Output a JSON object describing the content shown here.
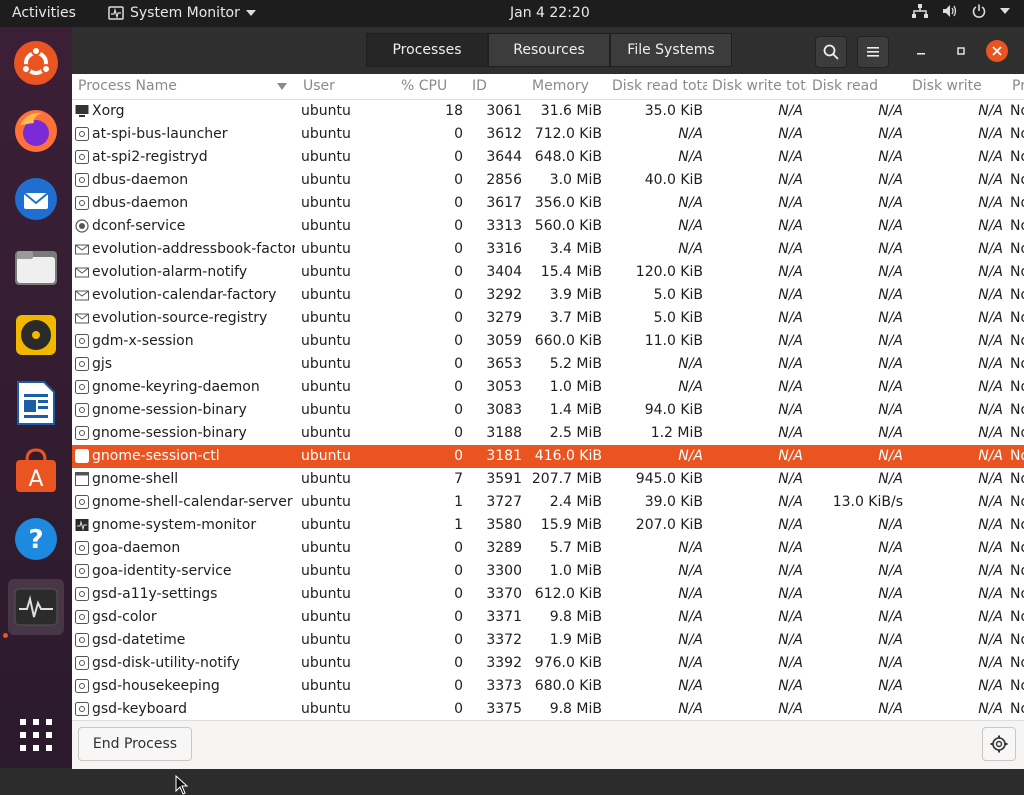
{
  "topbar": {
    "activities": "Activities",
    "app_name": "System Monitor",
    "clock": "Jan 4  22:20"
  },
  "dock": {
    "items": [
      "ubuntu-software-icon",
      "firefox-icon",
      "thunderbird-icon",
      "files-icon",
      "rhythmbox-icon",
      "libreoffice-writer-icon",
      "app-store-icon",
      "help-icon",
      "system-monitor-icon",
      "show-apps-icon"
    ]
  },
  "header": {
    "tabs": [
      "Processes",
      "Resources",
      "File Systems"
    ],
    "active_tab": "Processes"
  },
  "columns": {
    "name": "Process Name",
    "user": "User",
    "cpu": "% CPU",
    "id": "ID",
    "memory": "Memory",
    "disk_read_total": "Disk read total",
    "disk_write_total": "Disk write total",
    "disk_read": "Disk read",
    "disk_write": "Disk write",
    "priority": "Priority"
  },
  "processes": [
    {
      "name": "Xorg",
      "user": "ubuntu",
      "cpu": "18",
      "id": "3061",
      "mem": "31.6 MiB",
      "drt": "35.0 KiB",
      "dwt": "N/A",
      "dr": "N/A",
      "dw": "N/A",
      "pr": "Normal"
    },
    {
      "name": "at-spi-bus-launcher",
      "user": "ubuntu",
      "cpu": "0",
      "id": "3612",
      "mem": "712.0 KiB",
      "drt": "N/A",
      "dwt": "N/A",
      "dr": "N/A",
      "dw": "N/A",
      "pr": "Normal"
    },
    {
      "name": "at-spi2-registryd",
      "user": "ubuntu",
      "cpu": "0",
      "id": "3644",
      "mem": "648.0 KiB",
      "drt": "N/A",
      "dwt": "N/A",
      "dr": "N/A",
      "dw": "N/A",
      "pr": "Normal"
    },
    {
      "name": "dbus-daemon",
      "user": "ubuntu",
      "cpu": "0",
      "id": "2856",
      "mem": "3.0 MiB",
      "drt": "40.0 KiB",
      "dwt": "N/A",
      "dr": "N/A",
      "dw": "N/A",
      "pr": "Normal"
    },
    {
      "name": "dbus-daemon",
      "user": "ubuntu",
      "cpu": "0",
      "id": "3617",
      "mem": "356.0 KiB",
      "drt": "N/A",
      "dwt": "N/A",
      "dr": "N/A",
      "dw": "N/A",
      "pr": "Normal"
    },
    {
      "name": "dconf-service",
      "user": "ubuntu",
      "cpu": "0",
      "id": "3313",
      "mem": "560.0 KiB",
      "drt": "N/A",
      "dwt": "N/A",
      "dr": "N/A",
      "dw": "N/A",
      "pr": "Normal"
    },
    {
      "name": "evolution-addressbook-factory",
      "user": "ubuntu",
      "cpu": "0",
      "id": "3316",
      "mem": "3.4 MiB",
      "drt": "N/A",
      "dwt": "N/A",
      "dr": "N/A",
      "dw": "N/A",
      "pr": "Normal"
    },
    {
      "name": "evolution-alarm-notify",
      "user": "ubuntu",
      "cpu": "0",
      "id": "3404",
      "mem": "15.4 MiB",
      "drt": "120.0 KiB",
      "dwt": "N/A",
      "dr": "N/A",
      "dw": "N/A",
      "pr": "Normal"
    },
    {
      "name": "evolution-calendar-factory",
      "user": "ubuntu",
      "cpu": "0",
      "id": "3292",
      "mem": "3.9 MiB",
      "drt": "5.0 KiB",
      "dwt": "N/A",
      "dr": "N/A",
      "dw": "N/A",
      "pr": "Normal"
    },
    {
      "name": "evolution-source-registry",
      "user": "ubuntu",
      "cpu": "0",
      "id": "3279",
      "mem": "3.7 MiB",
      "drt": "5.0 KiB",
      "dwt": "N/A",
      "dr": "N/A",
      "dw": "N/A",
      "pr": "Normal"
    },
    {
      "name": "gdm-x-session",
      "user": "ubuntu",
      "cpu": "0",
      "id": "3059",
      "mem": "660.0 KiB",
      "drt": "11.0 KiB",
      "dwt": "N/A",
      "dr": "N/A",
      "dw": "N/A",
      "pr": "Normal"
    },
    {
      "name": "gjs",
      "user": "ubuntu",
      "cpu": "0",
      "id": "3653",
      "mem": "5.2 MiB",
      "drt": "N/A",
      "dwt": "N/A",
      "dr": "N/A",
      "dw": "N/A",
      "pr": "Normal"
    },
    {
      "name": "gnome-keyring-daemon",
      "user": "ubuntu",
      "cpu": "0",
      "id": "3053",
      "mem": "1.0 MiB",
      "drt": "N/A",
      "dwt": "N/A",
      "dr": "N/A",
      "dw": "N/A",
      "pr": "Normal"
    },
    {
      "name": "gnome-session-binary",
      "user": "ubuntu",
      "cpu": "0",
      "id": "3083",
      "mem": "1.4 MiB",
      "drt": "94.0 KiB",
      "dwt": "N/A",
      "dr": "N/A",
      "dw": "N/A",
      "pr": "Normal"
    },
    {
      "name": "gnome-session-binary",
      "user": "ubuntu",
      "cpu": "0",
      "id": "3188",
      "mem": "2.5 MiB",
      "drt": "1.2 MiB",
      "dwt": "N/A",
      "dr": "N/A",
      "dw": "N/A",
      "pr": "Normal"
    },
    {
      "name": "gnome-session-ctl",
      "user": "ubuntu",
      "cpu": "0",
      "id": "3181",
      "mem": "416.0 KiB",
      "drt": "N/A",
      "dwt": "N/A",
      "dr": "N/A",
      "dw": "N/A",
      "pr": "Normal",
      "selected": true
    },
    {
      "name": "gnome-shell",
      "user": "ubuntu",
      "cpu": "7",
      "id": "3591",
      "mem": "207.7 MiB",
      "drt": "945.0 KiB",
      "dwt": "N/A",
      "dr": "N/A",
      "dw": "N/A",
      "pr": "Normal"
    },
    {
      "name": "gnome-shell-calendar-server",
      "user": "ubuntu",
      "cpu": "1",
      "id": "3727",
      "mem": "2.4 MiB",
      "drt": "39.0 KiB",
      "dwt": "N/A",
      "dr": "13.0 KiB/s",
      "dw": "N/A",
      "pr": "Normal"
    },
    {
      "name": "gnome-system-monitor",
      "user": "ubuntu",
      "cpu": "1",
      "id": "3580",
      "mem": "15.9 MiB",
      "drt": "207.0 KiB",
      "dwt": "N/A",
      "dr": "N/A",
      "dw": "N/A",
      "pr": "Normal"
    },
    {
      "name": "goa-daemon",
      "user": "ubuntu",
      "cpu": "0",
      "id": "3289",
      "mem": "5.7 MiB",
      "drt": "N/A",
      "dwt": "N/A",
      "dr": "N/A",
      "dw": "N/A",
      "pr": "Normal"
    },
    {
      "name": "goa-identity-service",
      "user": "ubuntu",
      "cpu": "0",
      "id": "3300",
      "mem": "1.0 MiB",
      "drt": "N/A",
      "dwt": "N/A",
      "dr": "N/A",
      "dw": "N/A",
      "pr": "Normal"
    },
    {
      "name": "gsd-a11y-settings",
      "user": "ubuntu",
      "cpu": "0",
      "id": "3370",
      "mem": "612.0 KiB",
      "drt": "N/A",
      "dwt": "N/A",
      "dr": "N/A",
      "dw": "N/A",
      "pr": "Normal"
    },
    {
      "name": "gsd-color",
      "user": "ubuntu",
      "cpu": "0",
      "id": "3371",
      "mem": "9.8 MiB",
      "drt": "N/A",
      "dwt": "N/A",
      "dr": "N/A",
      "dw": "N/A",
      "pr": "Normal"
    },
    {
      "name": "gsd-datetime",
      "user": "ubuntu",
      "cpu": "0",
      "id": "3372",
      "mem": "1.9 MiB",
      "drt": "N/A",
      "dwt": "N/A",
      "dr": "N/A",
      "dw": "N/A",
      "pr": "Normal"
    },
    {
      "name": "gsd-disk-utility-notify",
      "user": "ubuntu",
      "cpu": "0",
      "id": "3392",
      "mem": "976.0 KiB",
      "drt": "N/A",
      "dwt": "N/A",
      "dr": "N/A",
      "dw": "N/A",
      "pr": "Normal"
    },
    {
      "name": "gsd-housekeeping",
      "user": "ubuntu",
      "cpu": "0",
      "id": "3373",
      "mem": "680.0 KiB",
      "drt": "N/A",
      "dwt": "N/A",
      "dr": "N/A",
      "dw": "N/A",
      "pr": "Normal"
    },
    {
      "name": "gsd-keyboard",
      "user": "ubuntu",
      "cpu": "0",
      "id": "3375",
      "mem": "9.8 MiB",
      "drt": "N/A",
      "dwt": "N/A",
      "dr": "N/A",
      "dw": "N/A",
      "pr": "Normal"
    }
  ],
  "footer": {
    "end_process": "End Process"
  },
  "colors": {
    "accent": "#e95420",
    "headerbar": "#2f2f2f",
    "topbar": "#1d1d1d"
  }
}
